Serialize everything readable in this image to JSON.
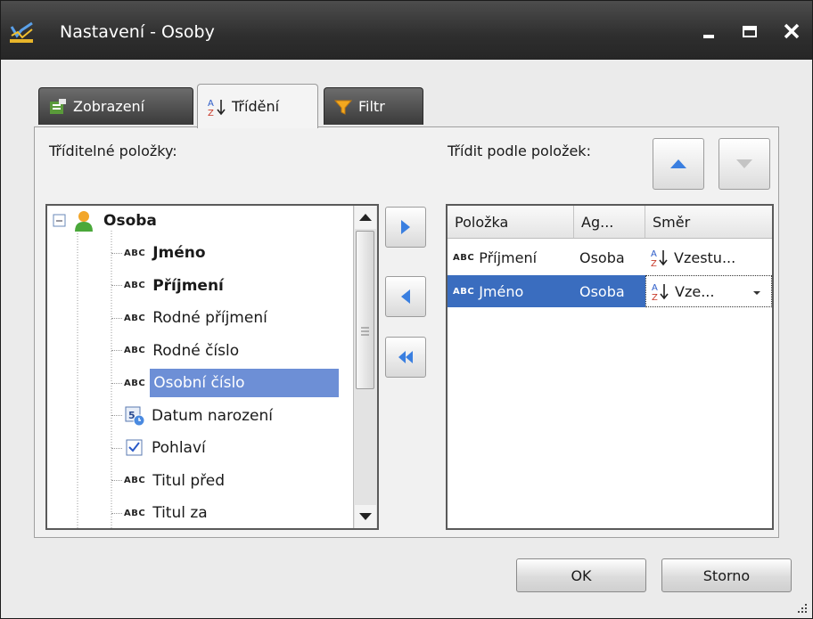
{
  "window": {
    "title": "Nastavení - Osoby"
  },
  "tabs": [
    {
      "label": "Zobrazení",
      "icon": "grid-view-icon"
    },
    {
      "label": "Třídění",
      "icon": "sort-az-icon"
    },
    {
      "label": "Filtr",
      "icon": "funnel-icon"
    }
  ],
  "left_label": "Tříditelné položky:",
  "right_label": "Třídit podle položek:",
  "tree": {
    "root": "Osoba",
    "abc_tag": "ABC",
    "items": [
      {
        "label": "Jméno",
        "bold": true,
        "type": "text"
      },
      {
        "label": "Příjmení",
        "bold": true,
        "type": "text"
      },
      {
        "label": "Rodné příjmení",
        "bold": false,
        "type": "text"
      },
      {
        "label": "Rodné číslo",
        "bold": false,
        "type": "text"
      },
      {
        "label": "Osobní číslo",
        "bold": false,
        "type": "text",
        "selected": true
      },
      {
        "label": "Datum narození",
        "bold": false,
        "type": "date"
      },
      {
        "label": "Pohlaví",
        "bold": false,
        "type": "bool"
      },
      {
        "label": "Titul před",
        "bold": false,
        "type": "text"
      },
      {
        "label": "Titul za",
        "bold": false,
        "type": "text"
      }
    ]
  },
  "grid": {
    "columns": [
      "Položka",
      "Ag...",
      "Směr"
    ],
    "rows": [
      {
        "item": "Příjmení",
        "agg": "Osoba",
        "dir": "Vzestu..."
      },
      {
        "item": "Jméno",
        "agg": "Osoba",
        "dir": "Vze..."
      }
    ]
  },
  "buttons": {
    "ok": "OK",
    "cancel": "Storno"
  },
  "colors": {
    "title_bg": "#2e2e2e",
    "selection": "#3a6dbf",
    "tree_selection": "#6d8fd6"
  }
}
